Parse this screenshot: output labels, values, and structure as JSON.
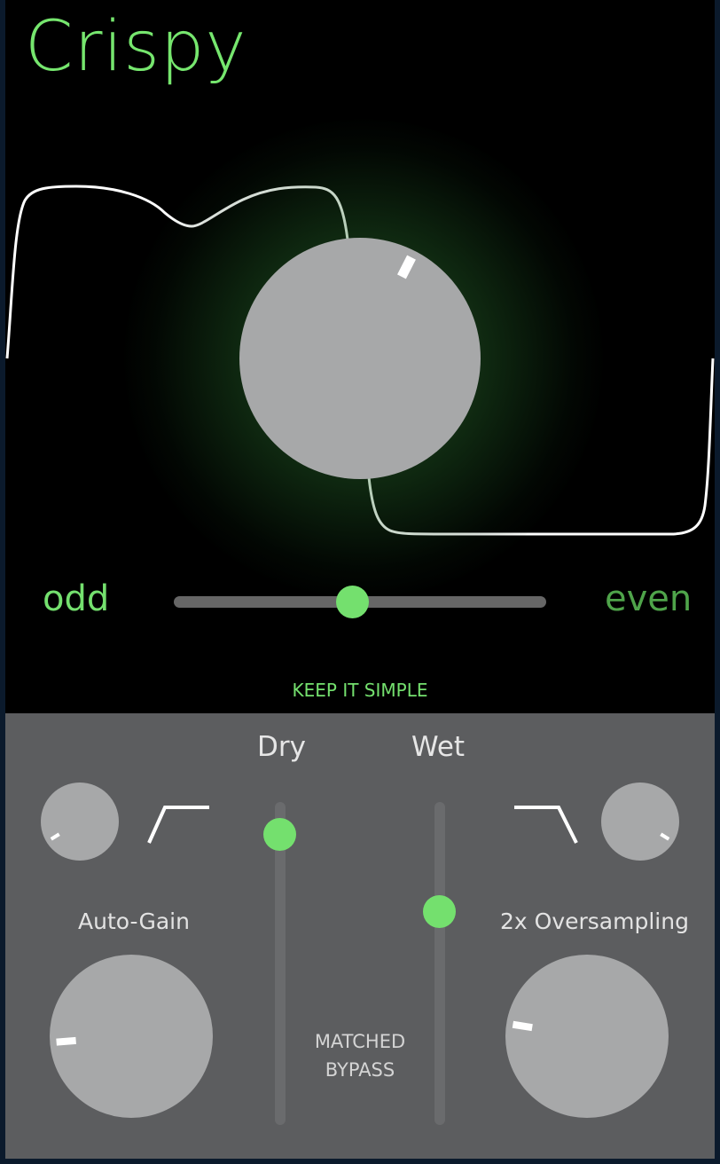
{
  "title": "Crispy",
  "accent_color": "#74e06e",
  "harmonics": {
    "left_label": "odd",
    "right_label": "even",
    "slider_value": 0.48
  },
  "drive_knob": {
    "value": 0.6
  },
  "mode_label": "KEEP IT SIMPLE",
  "bottom": {
    "dry_label": "Dry",
    "wet_label": "Wet",
    "dry_level": 0.9,
    "wet_level": 0.66,
    "low_cut_knob": {
      "value": 0.05
    },
    "high_cut_knob": {
      "value": 0.95
    },
    "auto_gain_label": "Auto-Gain",
    "oversampling_label": "2x Oversampling",
    "input_knob": {
      "value": 0.15
    },
    "output_knob": {
      "value": 0.2
    },
    "bypass_label_line1": "MATCHED",
    "bypass_label_line2": "BYPASS"
  }
}
